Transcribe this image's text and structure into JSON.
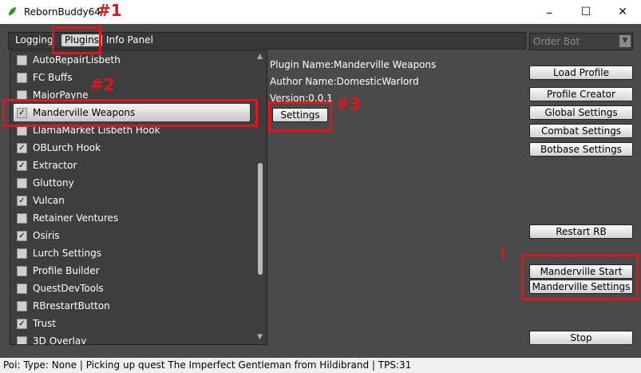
{
  "window": {
    "title": "RebornBuddy64 -",
    "minimize": "–",
    "maximize": "☐",
    "close": "✕"
  },
  "tabs": [
    {
      "label": "Logging"
    },
    {
      "label": "Plugins"
    },
    {
      "label": "Info Panel"
    }
  ],
  "plugins": [
    {
      "label": "AutoRepairLisbeth",
      "checked": false
    },
    {
      "label": "FC Buffs",
      "checked": false
    },
    {
      "label": "MajorPayne",
      "checked": false
    },
    {
      "label": "Manderville Weapons",
      "checked": true
    },
    {
      "label": "LlamaMarket Lisbeth Hook",
      "checked": false
    },
    {
      "label": "OBLurch Hook",
      "checked": true
    },
    {
      "label": "Extractor",
      "checked": true
    },
    {
      "label": "Gluttony",
      "checked": false
    },
    {
      "label": "Vulcan",
      "checked": true
    },
    {
      "label": "Retainer Ventures",
      "checked": false
    },
    {
      "label": "Osiris",
      "checked": true
    },
    {
      "label": "Lurch Settings",
      "checked": false
    },
    {
      "label": "Profile Builder",
      "checked": false
    },
    {
      "label": "QuestDevTools",
      "checked": false
    },
    {
      "label": "RBrestartButton",
      "checked": false
    },
    {
      "label": "Trust",
      "checked": true
    },
    {
      "label": "3D Overlay",
      "checked": false
    }
  ],
  "plugin_info": {
    "name": "Plugin Name:Manderville Weapons",
    "author": "Author Name:DomesticWarlord",
    "version": "Version:0.0.1",
    "settings_button": "Settings"
  },
  "botbase": {
    "selected": "Order Bot"
  },
  "sidebar_buttons": {
    "load_profile": "Load Profile",
    "profile_creator": "Profile Creator",
    "global_settings": "Global Settings",
    "combat_settings": "Combat Settings",
    "botbase_settings": "Botbase Settings",
    "restart_rb": "Restart RB",
    "manderville_start": "Manderville Start",
    "manderville_settings": "Manderville Settings",
    "stop": "Stop"
  },
  "annotations": {
    "a1": "#1",
    "a2": "#2",
    "a3": "#3",
    "ai": "i"
  },
  "status": {
    "text": "Poi: Type: None | Picking up quest The Imperfect Gentleman from Hildibrand | TPS:31"
  },
  "colors": {
    "annotation": "#e0161b",
    "panel": "#4a4a4a"
  }
}
